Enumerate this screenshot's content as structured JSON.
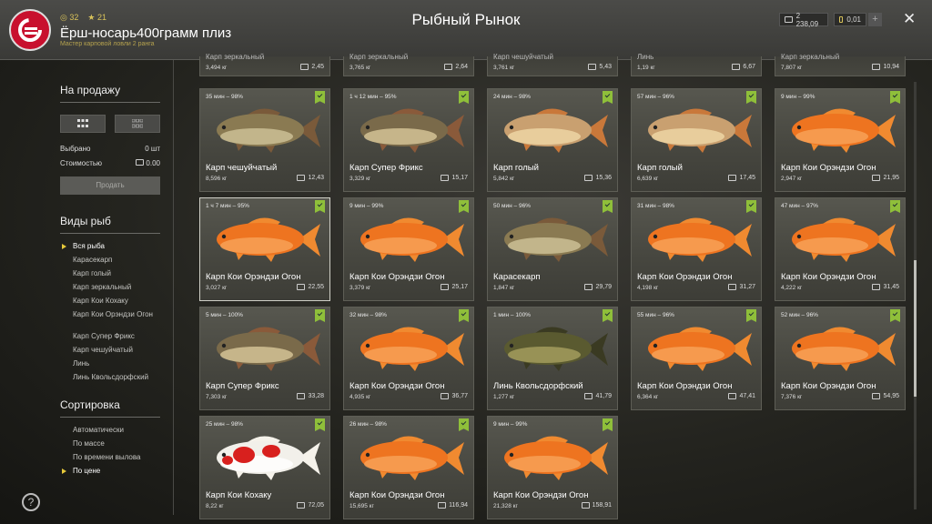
{
  "header": {
    "title": "Рыбный Рынок",
    "player_level": "32",
    "player_rank": "21",
    "player_name": "Ёрш-носарь400грамм плиз",
    "player_subtitle": "Мастер карповой ловли 2 ранга",
    "silver": "2 238,09",
    "gold": "0,01",
    "plus": "+",
    "close": "✕"
  },
  "sidebar": {
    "for_sale_title": "На продажу",
    "selected_label": "Выбрано",
    "selected_value": "0 шт",
    "cost_label": "Стоимостью",
    "cost_value": "0.00",
    "sell_button": "Продать",
    "fish_types_title": "Виды рыб",
    "fish_types": [
      "Вся рыба",
      "Карасекарп",
      "Карп голый",
      "Карп зеркальный",
      "Карп Кои Кохаку",
      "Карп Кои Орэндзи Огон",
      "Карп Супер Фрикс",
      "Карп чешуйчатый",
      "Линь",
      "Линь Квольсдорфский"
    ],
    "sort_title": "Сортировка",
    "sort_options": [
      "Автоматически",
      "По массе",
      "По времени вылова",
      "По цене"
    ],
    "help": "?"
  },
  "partial_row": [
    {
      "name": "Карп зеркальный",
      "weight": "3,494 кг",
      "price": "2,45"
    },
    {
      "name": "Карп зеркальный",
      "weight": "3,765 кг",
      "price": "2,64"
    },
    {
      "name": "Карп чешуйчатый",
      "weight": "3,761 кг",
      "price": "5,43"
    },
    {
      "name": "Линь",
      "weight": "1,19 кг",
      "price": "6,67"
    },
    {
      "name": "Карп зеркальный",
      "weight": "7,807 кг",
      "price": "10,94"
    }
  ],
  "cards": [
    {
      "meta": "35 мин – 98%",
      "name": "Карп чешуйчатый",
      "weight": "8,596 кг",
      "price": "12,43",
      "type": "scaly"
    },
    {
      "meta": "1 ч 12 мин – 95%",
      "name": "Карп Супер Фрикс",
      "weight": "3,329 кг",
      "price": "15,17",
      "type": "superfrix"
    },
    {
      "meta": "24 мин – 98%",
      "name": "Карп голый",
      "weight": "5,842 кг",
      "price": "15,36",
      "type": "naked"
    },
    {
      "meta": "57 мин – 96%",
      "name": "Карп голый",
      "weight": "6,639 кг",
      "price": "17,45",
      "type": "naked"
    },
    {
      "meta": "9 мин – 99%",
      "name": "Карп Кои Орэндзи Огон",
      "weight": "2,947 кг",
      "price": "21,95",
      "type": "orange"
    },
    {
      "meta": "1 ч 7 мин – 95%",
      "name": "Карп Кои Орэндзи Огон",
      "weight": "3,027 кг",
      "price": "22,55",
      "type": "orange"
    },
    {
      "meta": "9 мин – 99%",
      "name": "Карп Кои Орэндзи Огон",
      "weight": "3,379 кг",
      "price": "25,17",
      "type": "orange"
    },
    {
      "meta": "50 мин – 96%",
      "name": "Карасекарп",
      "weight": "1,847 кг",
      "price": "29,79",
      "type": "scaly"
    },
    {
      "meta": "31 мин – 98%",
      "name": "Карп Кои Орэндзи Огон",
      "weight": "4,198 кг",
      "price": "31,27",
      "type": "orange"
    },
    {
      "meta": "47 мин – 97%",
      "name": "Карп Кои Орэндзи Огон",
      "weight": "4,222 кг",
      "price": "31,45",
      "type": "orange"
    },
    {
      "meta": "5 мин – 100%",
      "name": "Карп Супер Фрикс",
      "weight": "7,303 кг",
      "price": "33,28",
      "type": "superfrix"
    },
    {
      "meta": "32 мин – 98%",
      "name": "Карп Кои Орэндзи Огон",
      "weight": "4,935 кг",
      "price": "36,77",
      "type": "orange"
    },
    {
      "meta": "1 мин – 100%",
      "name": "Линь Квольсдорфский",
      "weight": "1,277 кг",
      "price": "41,79",
      "type": "tench"
    },
    {
      "meta": "55 мин – 96%",
      "name": "Карп Кои Орэндзи Огон",
      "weight": "6,364 кг",
      "price": "47,41",
      "type": "orange"
    },
    {
      "meta": "52 мин – 96%",
      "name": "Карп Кои Орэндзи Огон",
      "weight": "7,376 кг",
      "price": "54,95",
      "type": "orange"
    },
    {
      "meta": "25 мин – 98%",
      "name": "Карп Кои Кохаку",
      "weight": "8,22 кг",
      "price": "72,05",
      "type": "kohaku"
    },
    {
      "meta": "26 мин – 98%",
      "name": "Карп Кои Орэндзи Огон",
      "weight": "15,695 кг",
      "price": "116,94",
      "type": "orange"
    },
    {
      "meta": "9 мин – 99%",
      "name": "Карп Кои Орэндзи Огон",
      "weight": "21,328 кг",
      "price": "158,91",
      "type": "orange"
    }
  ],
  "colors": {
    "accent": "#e6c93a",
    "check": "#8fbf3a",
    "orange_koi": "#ef7a22",
    "brand_red": "#c8102e"
  }
}
